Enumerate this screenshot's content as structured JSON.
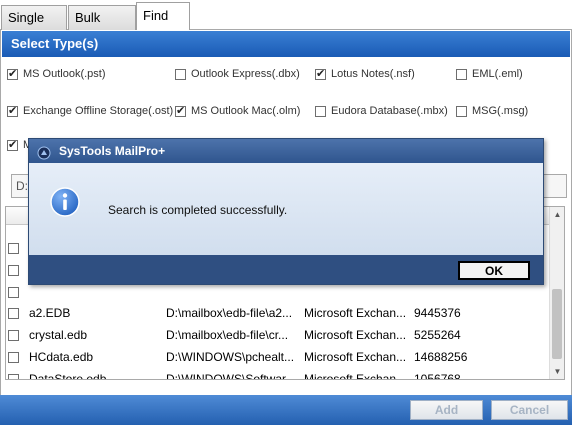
{
  "tabs": [
    {
      "label": "Single File"
    },
    {
      "label": "Bulk Mode"
    },
    {
      "label": "Find"
    }
  ],
  "select_types": {
    "title": "Select Type(s)",
    "options": [
      {
        "label": "MS Outlook(.pst)",
        "checked": true
      },
      {
        "label": "Outlook Express(.dbx)",
        "checked": false
      },
      {
        "label": "Lotus Notes(.nsf)",
        "checked": true
      },
      {
        "label": "EML(.eml)",
        "checked": false
      },
      {
        "label": "Exchange Offline Storage(.ost)",
        "checked": true
      },
      {
        "label": "MS Outlook Mac(.olm)",
        "checked": true
      },
      {
        "label": "Eudora Database(.mbx)",
        "checked": false
      },
      {
        "label": "MSG(.msg)",
        "checked": false
      },
      {
        "label": "M",
        "checked": true
      }
    ]
  },
  "search_path": {
    "value": "D:"
  },
  "results": {
    "rows": [
      {
        "name": "a2.EDB",
        "path": "D:\\mailbox\\edb-file\\a2...",
        "type": "Microsoft Exchan...",
        "size": "9445376"
      },
      {
        "name": "crystal.edb",
        "path": "D:\\mailbox\\edb-file\\cr...",
        "type": "Microsoft Exchan...",
        "size": "5255264"
      },
      {
        "name": "HCdata.edb",
        "path": "D:\\WINDOWS\\pchealt...",
        "type": "Microsoft Exchan...",
        "size": "14688256"
      },
      {
        "name": "DataStore.edb",
        "path": "D:\\WINDOWS\\Softwar...",
        "type": "Microsoft Exchan...",
        "size": "1056768"
      }
    ]
  },
  "buttons": {
    "add": "Add",
    "cancel": "Cancel"
  },
  "dialog": {
    "title": "SysTools MailPro+",
    "message": "Search is completed successfully.",
    "ok_label": "OK"
  },
  "colors": {
    "header_blue": "#1a5bb5",
    "dialog_frame": "#2f4f81",
    "info_icon_blue": "#1f5fbf"
  }
}
